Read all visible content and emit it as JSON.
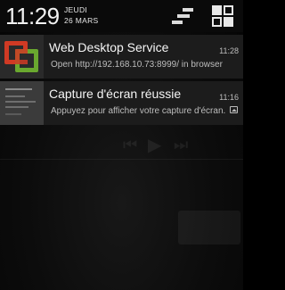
{
  "status_header": {
    "time": "11:29",
    "day": "JEUDI",
    "date": "26 MARS"
  },
  "notifications": [
    {
      "title": "Web Desktop Service",
      "subtitle": "Open http://192.168.10.73:8999/ in browser",
      "time": "11:28",
      "icon": "web-desktop-service-icon"
    },
    {
      "title": "Capture d'écran réussie",
      "subtitle": "Appuyez pour afficher votre capture d'écran.",
      "time": "11:16",
      "icon": "screenshot-thumbnail-icon",
      "badge_icon": "picture-icon"
    }
  ],
  "colors": {
    "shade_background": "#0a0a0a",
    "notification_background": "#1c1c1c",
    "text_primary": "#f5f5f5",
    "text_secondary": "#bdbdbd",
    "app_icon_red": "#d03a24",
    "app_icon_green": "#6aa82f"
  }
}
